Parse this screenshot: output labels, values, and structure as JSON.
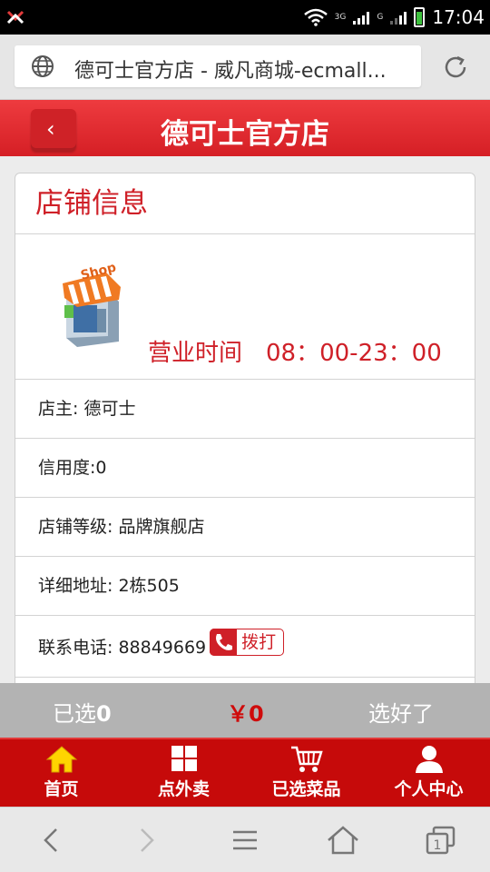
{
  "statusbar": {
    "time": "17:04",
    "network": "3G",
    "network2": "G"
  },
  "browser": {
    "url_title": "德可士官方店 - 威凡商城-ecmall..."
  },
  "header": {
    "title": "德可士官方店"
  },
  "card": {
    "title": "店铺信息",
    "hours_label": "营业时间",
    "hours_value": "08：00-23：00",
    "owner": "店主: 德可士",
    "credit": "信用度:0",
    "level": "店铺等级: 品牌旗舰店",
    "address": "详细地址: 2栋505",
    "phone": "联系电话: 88849669",
    "call_label": "拨打",
    "shop_sign": "Shop"
  },
  "summary": {
    "selected_label": "已选",
    "selected_count": "0",
    "price": "￥0",
    "done_label": "选好了"
  },
  "tabs": [
    {
      "label": "首页",
      "icon": "home-icon"
    },
    {
      "label": "点外卖",
      "icon": "grid-icon"
    },
    {
      "label": "已选菜品",
      "icon": "cart-icon"
    },
    {
      "label": "个人中心",
      "icon": "person-icon"
    }
  ],
  "colors": {
    "brand_red": "#cf2028",
    "tab_red": "#c60a0a",
    "home_active": "#ffd400"
  }
}
